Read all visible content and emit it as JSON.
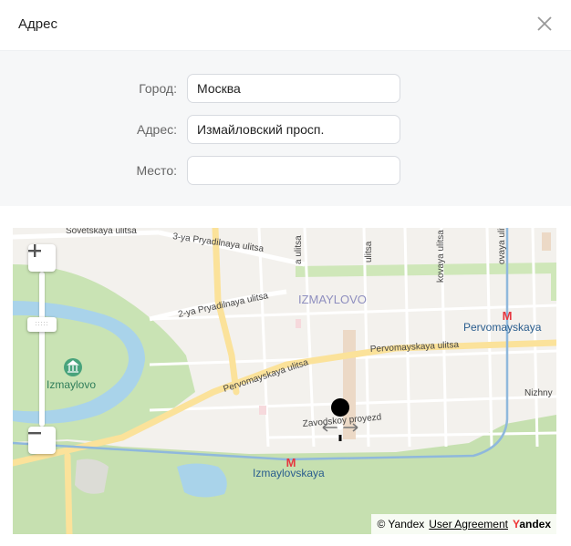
{
  "dialog": {
    "title": "Адрес"
  },
  "form": {
    "city": {
      "label": "Город:",
      "value": "Москва"
    },
    "address": {
      "label": "Адрес:",
      "value": "Измайловский просп."
    },
    "place": {
      "label": "Место:",
      "value": ""
    }
  },
  "map": {
    "zoom_in_label": "+",
    "zoom_out_label": "−",
    "zoom_level": 0.66,
    "labels": {
      "sovetskaya": "Sovetskaya ulitsa",
      "pryad3": "3-ya Pryadilnaya ulitsa",
      "pryad2": "2-ya Pryadilnaya ulitsa",
      "pervomay_ul": "Pervomayskaya ulitsa",
      "izmaylovo_district": "IZMAYLOVO",
      "pervomayskaya_metro": "Pervomayskaya",
      "izmaylovo_park": "Izmaylovo",
      "nizhny": "Nizhny",
      "zavodskoy": "Zavodskoy proyezd",
      "izmaylovskaya_metro": "Izmaylovskaya",
      "v1": "a ulitsa",
      "v2": "ulitsa",
      "v3": "kovaya ulitsa",
      "v4": "ovaya ulitsa"
    },
    "copyright": {
      "prefix": "© Yandex",
      "link": "User Agreement",
      "logo_first": "Y",
      "logo_rest": "andex"
    },
    "colors": {
      "land": "#f3f1ed",
      "park": "#c9e3b4",
      "water": "#a9d3ea",
      "road_major": "#fbe29a",
      "metro_line": "#8fb8dc",
      "metro": "#e6363f",
      "marker": "#000000"
    }
  }
}
